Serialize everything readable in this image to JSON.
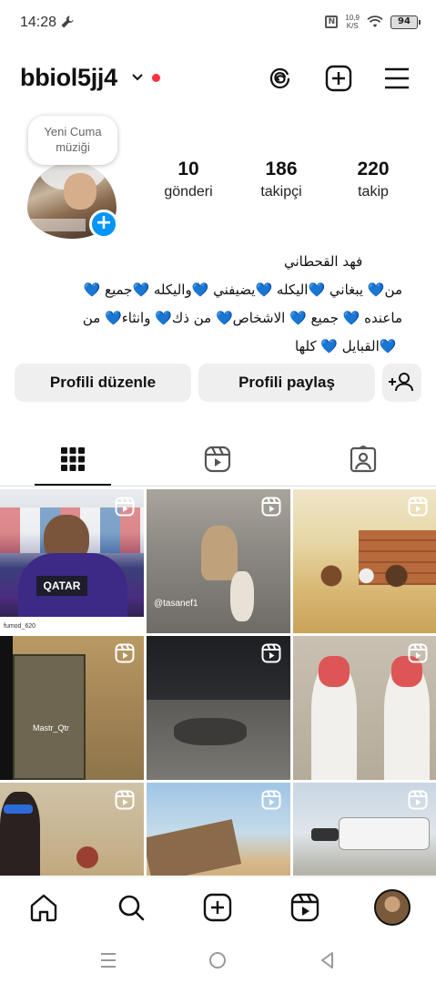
{
  "status_bar": {
    "time": "14:28",
    "speed_top": "10,9",
    "speed_bottom": "K/S",
    "battery": "94",
    "icons": [
      "wrench-icon",
      "nfc-icon",
      "wifi-icon",
      "battery-icon"
    ]
  },
  "header": {
    "username": "bbiol5jj4",
    "icons": [
      "threads-icon",
      "create-plus-icon",
      "menu-icon"
    ],
    "notification_dot_color": "#ff3040"
  },
  "profile": {
    "note_line1": "Yeni Cuma",
    "note_line2": "müziği",
    "stats": [
      {
        "value": "10",
        "label": "gönderi"
      },
      {
        "value": "186",
        "label": "takipçi"
      },
      {
        "value": "220",
        "label": "takip"
      }
    ],
    "name": "فهد القحطاني",
    "bio_lines": [
      "من💙 يبغاني 💙اليكله 💙يضيفني 💙واليكله 💙جميع 💙",
      "ماعنده 💙 جميع 💙 الاشخاص💙 من ذك💙 وانثاء💙 من",
      "💙القبايل 💙 كلها"
    ]
  },
  "buttons": {
    "edit_profile": "Profili düzenle",
    "share_profile": "Profili paylaş"
  },
  "tabs": [
    "grid-icon",
    "reels-icon",
    "tagged-icon"
  ],
  "grid": {
    "items": [
      {
        "type": "reel",
        "overlay": "",
        "caption": "QATAR"
      },
      {
        "type": "reel",
        "overlay": "@tasanef1",
        "caption": ""
      },
      {
        "type": "reel",
        "overlay": "",
        "caption": ""
      },
      {
        "type": "reel",
        "overlay": "Mastr_Qtr",
        "caption": ""
      },
      {
        "type": "reel",
        "overlay": "",
        "caption": ""
      },
      {
        "type": "reel",
        "overlay": "",
        "caption": ""
      },
      {
        "type": "reel",
        "overlay": "",
        "caption": ""
      },
      {
        "type": "reel",
        "overlay": "",
        "caption": ""
      },
      {
        "type": "reel",
        "overlay": "",
        "caption": ""
      }
    ],
    "tag_bottom_left": "fumod_620"
  },
  "bottom_nav": [
    "home-icon",
    "search-icon",
    "create-icon",
    "reels-icon",
    "profile-avatar"
  ],
  "system_nav": [
    "recents-icon",
    "home-circle-icon",
    "back-icon"
  ],
  "colors": {
    "accent": "#0095f6",
    "button_bg": "#efefef"
  }
}
